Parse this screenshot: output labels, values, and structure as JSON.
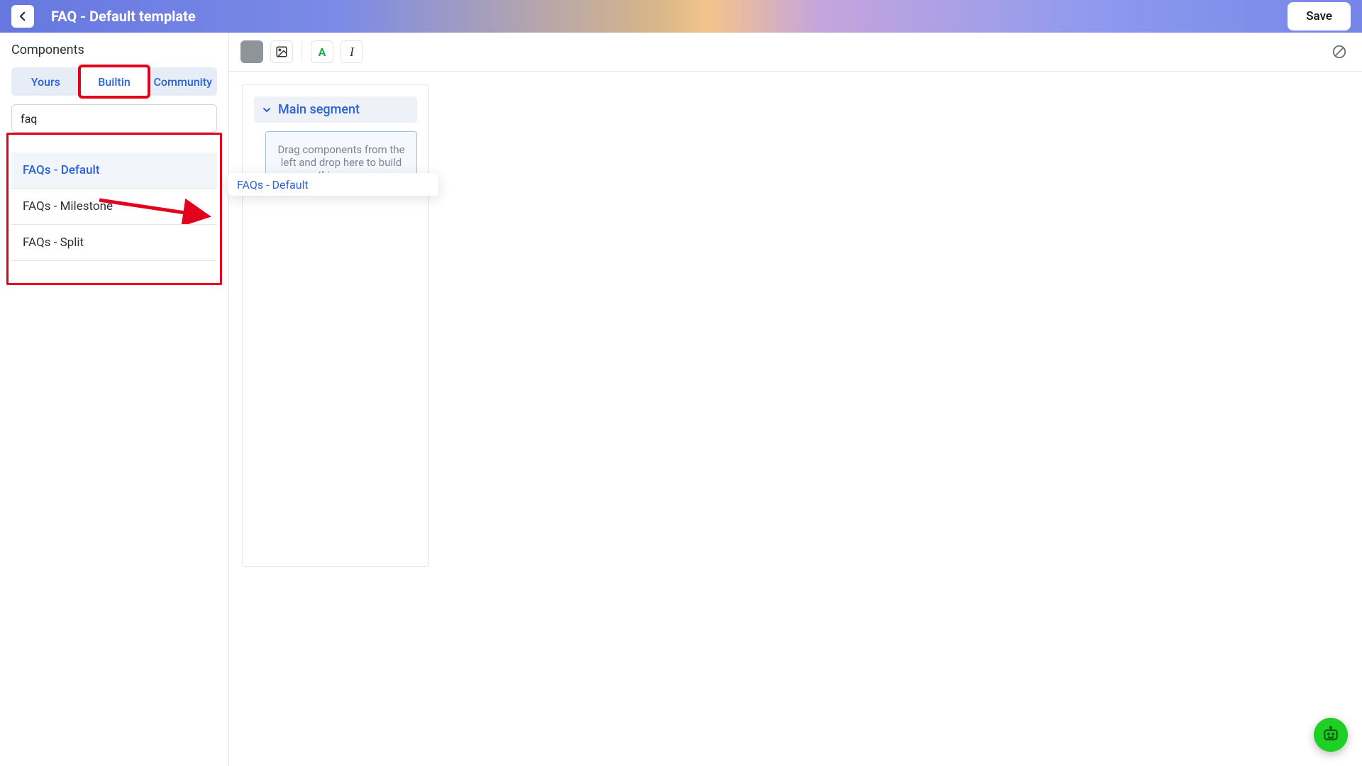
{
  "header": {
    "title": "FAQ - Default template",
    "save_label": "Save"
  },
  "sidebar": {
    "title": "Components",
    "tabs": [
      {
        "label": "Yours"
      },
      {
        "label": "Builtin"
      },
      {
        "label": "Community"
      }
    ],
    "active_tab_index": 1,
    "search_value": "faq",
    "results": [
      {
        "label": "FAQs - Default",
        "selected": true
      },
      {
        "label": "FAQs - Milestone",
        "selected": false
      },
      {
        "label": "FAQs - Split",
        "selected": false
      }
    ]
  },
  "toolbar": {
    "color_swatch": "#8f949a",
    "text_color_letter": "A",
    "italic_letter": "I"
  },
  "canvas": {
    "segment_title": "Main segment",
    "dropzone_text": "Drag components from the left and drop here to build this page."
  },
  "drag_preview": {
    "label": "FAQs - Default"
  },
  "annotation": {
    "highlight_tab": "Builtin",
    "arrow_from": "FAQs - Default list item",
    "arrow_to": "canvas dropzone"
  }
}
